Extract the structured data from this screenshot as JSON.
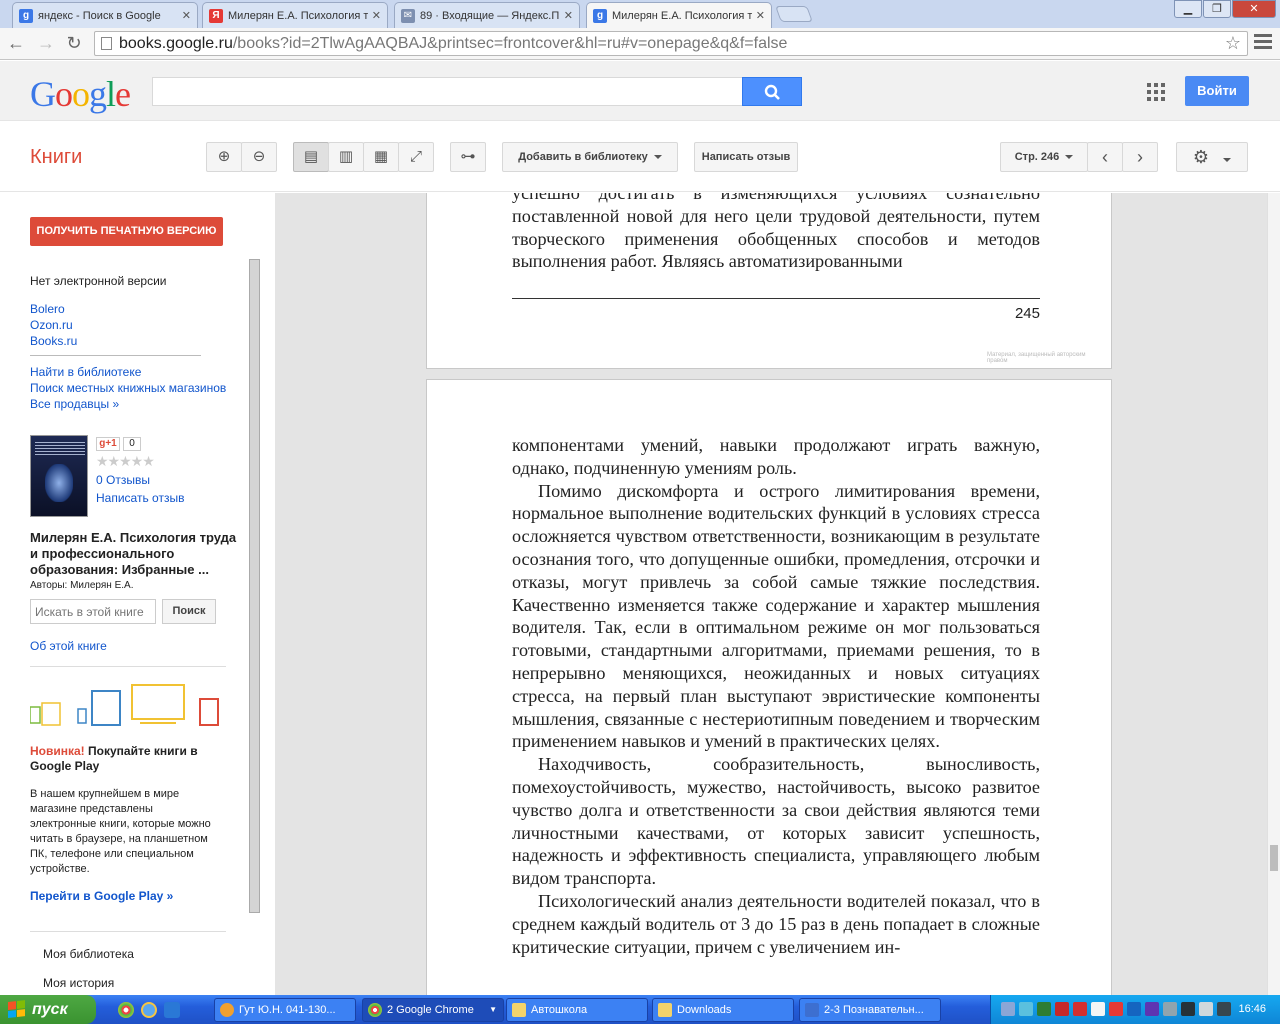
{
  "browser": {
    "tabs": [
      {
        "title": "яндекс - Поиск в Google",
        "favicon": "google-g-icon",
        "color": "#3b78e7"
      },
      {
        "title": "Милерян Е.А. Психология т",
        "favicon": "yandex-icon",
        "color": "#e53935"
      },
      {
        "title": "89 · Входящие — Яндекс.П",
        "favicon": "mail-icon",
        "color": "#7d8fb0"
      },
      {
        "title": "Милерян Е.А. Психология т",
        "favicon": "google-g-icon",
        "color": "#3b78e7"
      }
    ],
    "url_host": "books.google.ru",
    "url_rest": "/books?id=2TlwAgAAQBAJ&printsec=frontcover&hl=ru#v=onepage&q&f=false"
  },
  "google_header": {
    "logo": "Google",
    "sign_in": "Войти"
  },
  "books_toolbar": {
    "title": "Книги",
    "add_to_library": "Добавить в библиотеку",
    "write_review": "Написать отзыв",
    "page_select": "Стр. 246"
  },
  "sidebar": {
    "print_version": "ПОЛУЧИТЬ ПЕЧАТНУЮ ВЕРСИЮ",
    "no_ebook": "Нет электронной версии",
    "sellers": [
      "Bolero",
      "Ozon.ru",
      "Books.ru"
    ],
    "find_links": [
      "Найти в библиотеке",
      "Поиск местных книжных магазинов",
      "Все продавцы »"
    ],
    "gplus_label": "g+1",
    "gplus_count": "0",
    "stars": "★★★★★",
    "reviews_count": "0 Отзывы",
    "write_review": "Написать отзыв",
    "book_title": "Милерян Е.А. Психология труда и профессионального образования: Избранные ...",
    "authors": "Авторы: Милерян Е.А.",
    "inbook_search_placeholder": "Искать в этой книге",
    "inbook_search_button": "Поиск",
    "about_book": "Об этой книге",
    "promo_new": "Новинка!",
    "promo_title": "Покупайте книги в Google Play",
    "promo_body": "В нашем крупнейшем в мире магазине представлены электронные книги, которые можно читать в браузере, на планшетном ПК, телефоне или специальном устройстве.",
    "promo_link": "Перейти в Google Play »",
    "my_library": "Моя библиотека",
    "my_history": "Моя история"
  },
  "viewer": {
    "page245": {
      "lines": "успешно достигать в изменяющихся условиях сознательно поставленной новой для него цели трудовой деятельности, путем творческого применения обобщенных способов и методов выполнения работ. Являясь автоматизированными",
      "page_number": "245",
      "copyright": "Материал, защищенный авторским правом"
    },
    "page246": {
      "paragraphs": [
        {
          "indent": false,
          "text": "компонентами умений, навыки продолжают играть важную, однако, подчиненную умениям роль."
        },
        {
          "indent": true,
          "text": "Помимо дискомфорта и острого лимитирования времени, нормальное выполнение водительских функций в условиях стресса осложняется чувством ответственности, возникающим в результате осознания того, что допущенные ошибки, промедления, отсрочки и отказы, могут привлечь за собой самые тяжкие последствия. Качественно изменяется также содержание и характер мышления водителя. Так, если в оптимальном режиме он мог пользоваться готовыми, стандартными алгоритмами, приемами решения, то в непрерывно меняющихся, неожиданных и новых ситуациях стресса, на первый план выступают эвристические компоненты мышления, связанные с нестериотипным поведением и творческим применением навыков и умений в практических целях."
        },
        {
          "indent": true,
          "text": "Находчивость, сообразительность, выносливость, помехоустойчивость, мужество, настойчивость, высоко развитое чувство долга и ответственности за свои действия являются теми личностными качествами, от которых зависит успешность, надежность и эффективность специалиста, управляющего любым видом транспорта."
        },
        {
          "indent": true,
          "text": "Психологический анализ деятельности водителей показал, что в среднем каждый водитель от 3 до 15 раз в день попадает в сложные критические ситуации, причем с увеличением ин-"
        }
      ]
    }
  },
  "taskbar": {
    "start": "пуск",
    "tasks": [
      {
        "label": "Гут Ю.Н. 041-130...",
        "icon_color": "#f0a030"
      },
      {
        "label": "2 Google Chrome",
        "icon_color": "#e44"
      },
      {
        "label": "Автошкола",
        "icon_color": "#f3d36b"
      },
      {
        "label": "Downloads",
        "icon_color": "#f3d36b"
      },
      {
        "label": "2-3 Познавательн...",
        "icon_color": "#3d6fd0"
      }
    ],
    "clock": "16:46"
  }
}
